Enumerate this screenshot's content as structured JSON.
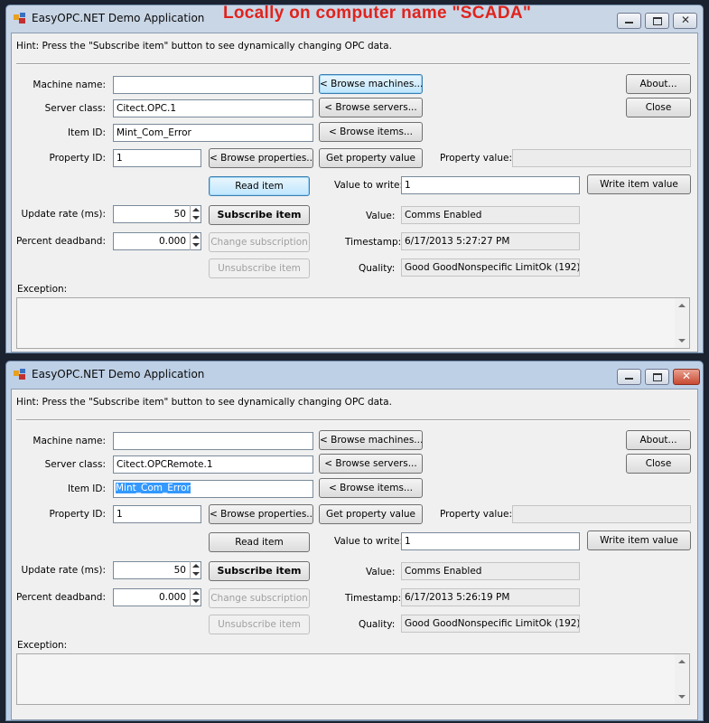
{
  "overlay_caption": "Locally on computer name \"SCADA\"",
  "windows": [
    {
      "title": "EasyOPC.NET Demo Application",
      "hint": "Hint: Press the \"Subscribe item\" button to see dynamically changing OPC data.",
      "labels": {
        "machine_name": "Machine name:",
        "server_class": "Server class:",
        "item_id": "Item ID:",
        "property_id": "Property ID:",
        "property_value": "Property value:",
        "value_to_write": "Value to write:",
        "update_rate": "Update rate (ms):",
        "percent_deadband": "Percent deadband:",
        "value": "Value:",
        "timestamp": "Timestamp:",
        "quality": "Quality:",
        "exception": "Exception:"
      },
      "fields": {
        "machine_name": "",
        "server_class": "Citect.OPC.1",
        "item_id": "Mint_Com_Error",
        "property_id": "1",
        "property_value": "",
        "value_to_write": "1",
        "update_rate": "50",
        "percent_deadband": "0.000",
        "value": "Comms Enabled",
        "timestamp": "6/17/2013 5:27:27 PM",
        "quality": "Good GoodNonspecific LimitOk (192)"
      },
      "buttons": {
        "browse_machines": "< Browse machines...",
        "browse_servers": "< Browse servers...",
        "browse_items": "< Browse items...",
        "browse_properties": "< Browse properties...",
        "get_property_value": "Get property value",
        "read_item": "Read item",
        "write_item_value": "Write item value",
        "subscribe_item": "Subscribe item",
        "change_subscription": "Change subscription",
        "unsubscribe_item": "Unsubscribe item",
        "about": "About...",
        "close": "Close"
      }
    },
    {
      "title": "EasyOPC.NET Demo Application",
      "hint": "Hint: Press the \"Subscribe item\" button to see dynamically changing OPC data.",
      "labels": {
        "machine_name": "Machine name:",
        "server_class": "Server class:",
        "item_id": "Item ID:",
        "property_id": "Property ID:",
        "property_value": "Property value:",
        "value_to_write": "Value to write:",
        "update_rate": "Update rate (ms):",
        "percent_deadband": "Percent deadband:",
        "value": "Value:",
        "timestamp": "Timestamp:",
        "quality": "Quality:",
        "exception": "Exception:"
      },
      "fields": {
        "machine_name": "",
        "server_class": "Citect.OPCRemote.1",
        "item_id": "Mint_Com_Error",
        "property_id": "1",
        "property_value": "",
        "value_to_write": "1",
        "update_rate": "50",
        "percent_deadband": "0.000",
        "value": "Comms Enabled",
        "timestamp": "6/17/2013 5:26:19 PM",
        "quality": "Good GoodNonspecific LimitOk (192)"
      },
      "buttons": {
        "browse_machines": "< Browse machines...",
        "browse_servers": "< Browse servers...",
        "browse_items": "< Browse items...",
        "browse_properties": "< Browse properties...",
        "get_property_value": "Get property value",
        "read_item": "Read item",
        "write_item_value": "Write item value",
        "subscribe_item": "Subscribe item",
        "change_subscription": "Change subscription",
        "unsubscribe_item": "Unsubscribe item",
        "about": "About...",
        "close": "Close"
      }
    }
  ],
  "colors": {
    "caption_red": "#e0231c",
    "selection_blue": "#3399ff"
  },
  "icons": [
    "app-icon",
    "minimize-icon",
    "maximize-icon",
    "close-icon",
    "scroll-up-icon",
    "scroll-down-icon",
    "spin-up-icon",
    "spin-down-icon"
  ]
}
